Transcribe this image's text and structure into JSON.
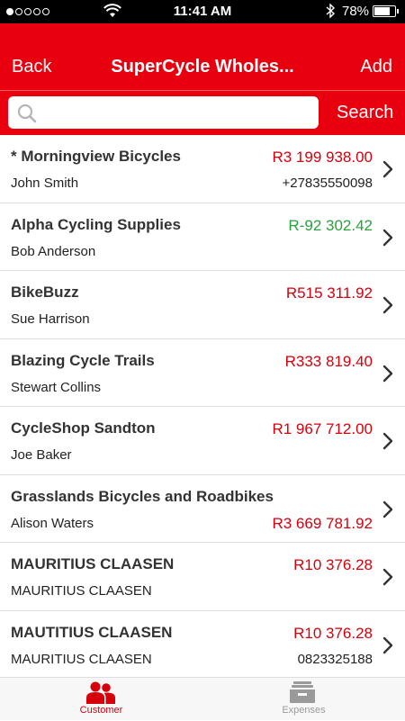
{
  "status_bar": {
    "time": "11:41 AM",
    "battery_pct": "78%",
    "battery_level": 0.78,
    "signal_bars": 1
  },
  "nav": {
    "back_label": "Back",
    "title": "SuperCycle Wholes...",
    "add_label": "Add"
  },
  "search": {
    "value": "",
    "placeholder": "",
    "button_label": "Search"
  },
  "customers": [
    {
      "name": "* Morningview Bicycles",
      "contact": "John Smith",
      "amount": "R3 199 938.00",
      "phone": "+27835550098",
      "amount_color": "red"
    },
    {
      "name": "Alpha Cycling Supplies",
      "contact": "Bob Anderson",
      "amount": "R-92 302.42",
      "phone": "",
      "amount_color": "green"
    },
    {
      "name": "BikeBuzz",
      "contact": "Sue Harrison",
      "amount": "R515 311.92",
      "phone": "",
      "amount_color": "red"
    },
    {
      "name": "Blazing Cycle Trails",
      "contact": "Stewart Collins",
      "amount": "R333 819.40",
      "phone": "",
      "amount_color": "red"
    },
    {
      "name": "CycleShop Sandton",
      "contact": "Joe Baker",
      "amount": "R1 967 712.00",
      "phone": "",
      "amount_color": "red"
    },
    {
      "name": "Grasslands Bicycles and Roadbikes",
      "contact": "Alison Waters",
      "amount": "R3 669 781.92",
      "phone": "",
      "amount_color": "red"
    },
    {
      "name": "MAURITIUS CLAASEN",
      "contact": "MAURITIUS CLAASEN",
      "amount": "R10 376.28",
      "phone": "",
      "amount_color": "red"
    },
    {
      "name": "MAUTITIUS CLAASEN",
      "contact": "MAURITIUS CLAASEN",
      "amount": "R10 376.28",
      "phone": "0823325188",
      "amount_color": "red"
    }
  ],
  "tabs": {
    "customer_label": "Customer",
    "expenses_label": "Expenses"
  },
  "colors": {
    "brand_red": "#e8000f",
    "amount_red": "#d6000c",
    "amount_green": "#2ba03c"
  },
  "icons": {
    "search": "search-icon",
    "chevron": "chevron-right-icon",
    "customer_tab": "people-icon",
    "expenses_tab": "tray-icon"
  }
}
